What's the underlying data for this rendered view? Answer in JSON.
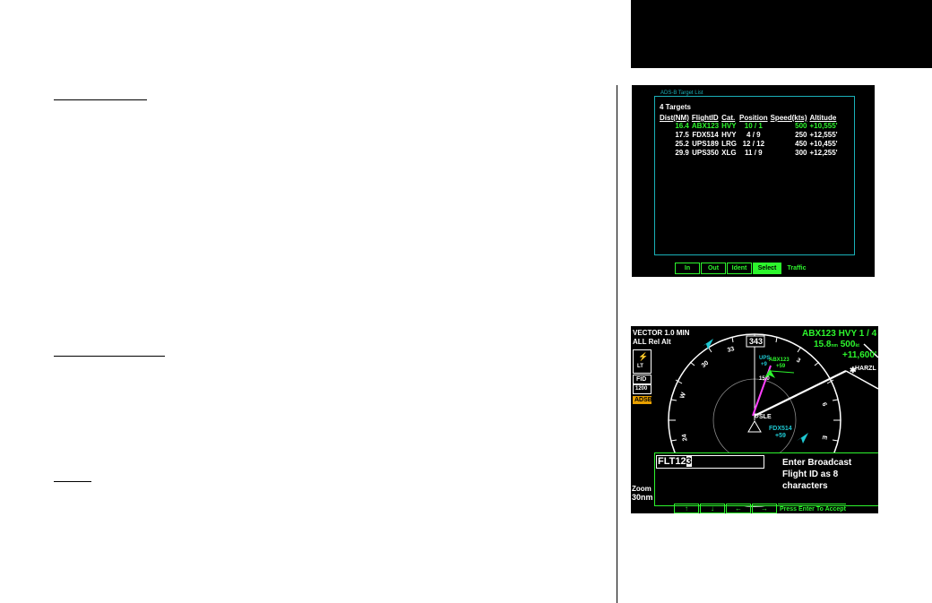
{
  "target_list": {
    "title": "ADS-B Target List",
    "count": "4 Targets",
    "headers": [
      "Dist(NM)",
      "FlightID",
      "Cat.",
      "Position",
      "Speed(kts)",
      "Altitude"
    ],
    "rows": [
      {
        "dist": "16.4",
        "id": "ABX123",
        "cat": "HVY",
        "pos": "10 / 1",
        "speed": "500",
        "alt": "+10,555'"
      },
      {
        "dist": "17.5",
        "id": "FDX514",
        "cat": "HVY",
        "pos": "4 / 9",
        "speed": "250",
        "alt": "+12,555'"
      },
      {
        "dist": "25.2",
        "id": "UPS189",
        "cat": "LRG",
        "pos": "12 / 12",
        "speed": "450",
        "alt": "+10,455'"
      },
      {
        "dist": "29.9",
        "id": "UPS350",
        "cat": "XLG",
        "pos": "11 / 9",
        "speed": "300",
        "alt": "+12,255'"
      }
    ],
    "softkeys": [
      "In",
      "Out",
      "Ident",
      "Select",
      "Traffic"
    ]
  },
  "traffic": {
    "mode_line1": "VECTOR 1.0 MIN",
    "mode_line2": "ALL Rel Alt",
    "heading": "343",
    "target_line1": "ABX123 HVY 1 / 4",
    "target_line2": "15.8",
    "target_line2_unit": "nm",
    "target_line2_speed": "500",
    "target_line2_speed_unit": "kt",
    "target_line3": "+11,600'",
    "waypoint": "HARZL",
    "station": "SLE",
    "ring_label": "15.0",
    "labels": {
      "ups": "UPS",
      "ups_alt": "+9",
      "abx": "ABX123",
      "abx_alt": "+59",
      "fdx": "FDX514",
      "fdx_alt": "+59"
    },
    "left_buttons": {
      "lt": "LT",
      "fid": "FID",
      "squawk": "1200",
      "adsb": "ADSB"
    },
    "zoom_label": "Zoom",
    "zoom_value": "30nm",
    "entry": {
      "value": "FLT12",
      "cursor_char": "3",
      "prompt": "Enter Broadcast Flight ID as 8 characters"
    },
    "bottom_hint": "Press Enter To Accept",
    "bottom_arrows": [
      "↑",
      "↓",
      "←",
      "→"
    ]
  },
  "colors": {
    "green": "#2df52d",
    "cyan": "#1ec8d2",
    "magenta": "#ff40ff"
  }
}
